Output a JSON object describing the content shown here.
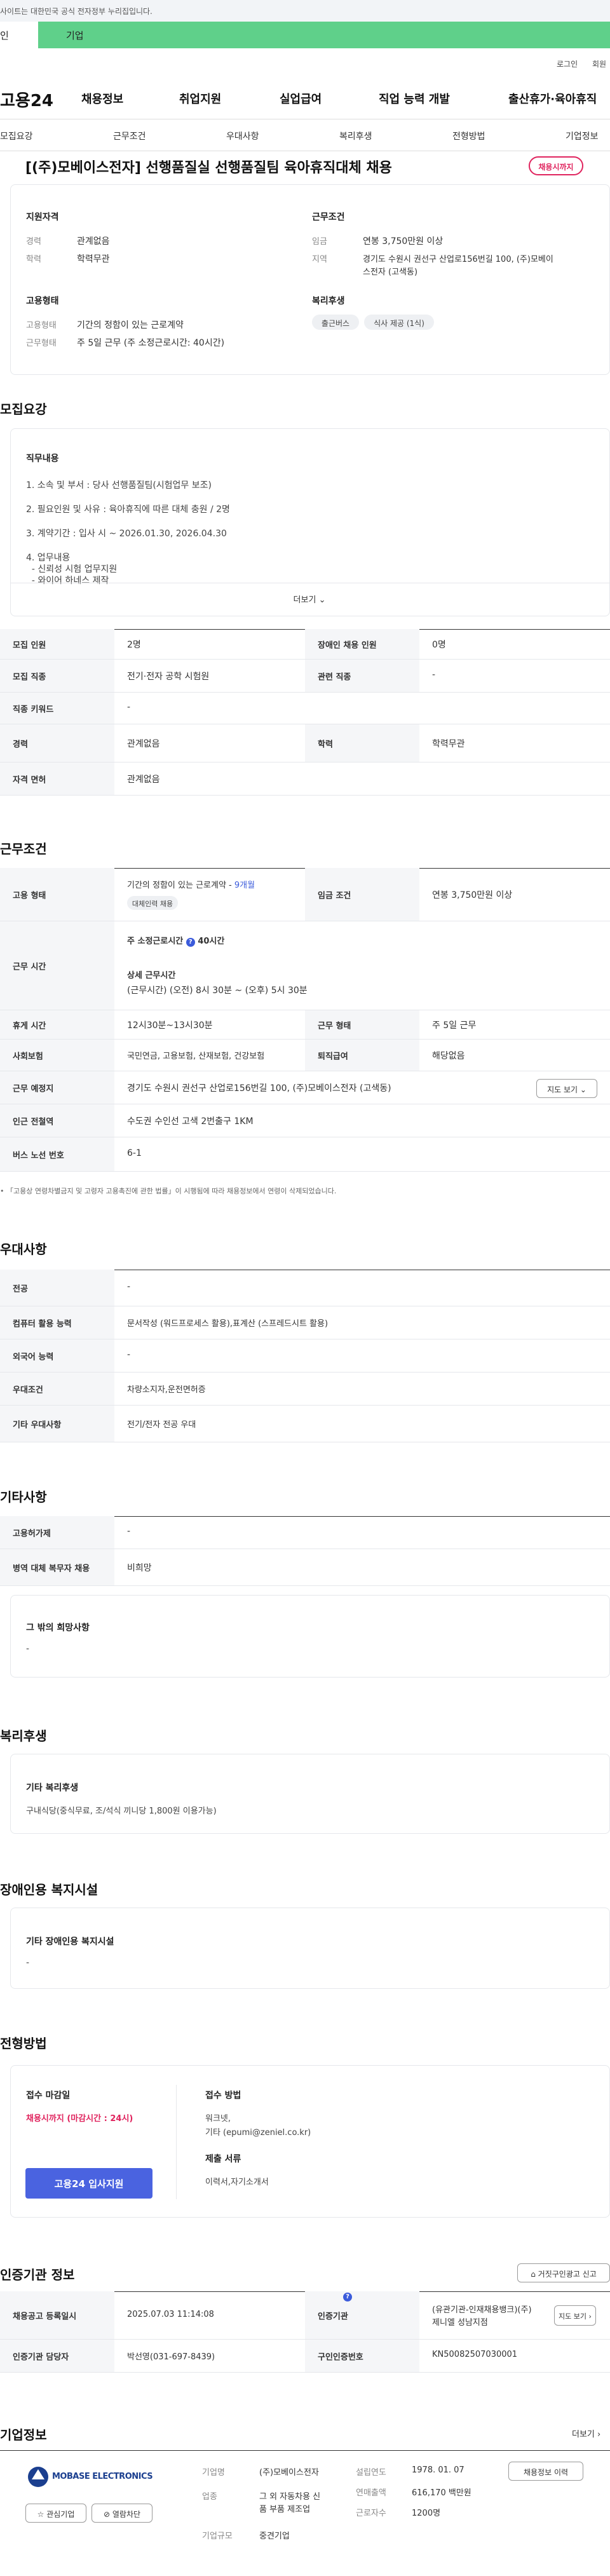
{
  "topbar": {
    "notice": "사이트는 대한민국 공식 전자정부 누리집입니다."
  },
  "mode": {
    "individual": "인",
    "business": "기업"
  },
  "util": {
    "login": "로그인",
    "join": "회원"
  },
  "gnb": {
    "logo": "고용24",
    "menus": [
      "채용정보",
      "취업지원",
      "실업급여",
      "직업 능력 개발",
      "출산휴가·육아휴직"
    ]
  },
  "tabs": [
    "모집요강",
    "근무조건",
    "우대사항",
    "복리후생",
    "전형방법",
    "기업정보"
  ],
  "job": {
    "title": "[(주)모베이스전자] 선행품질실 선행품질팀 육아휴직대체 채용",
    "status": "채용시까지"
  },
  "summary": {
    "qual_title": "지원자격",
    "career_label": "경력",
    "career": "관계없음",
    "edu_label": "학력",
    "edu": "학력무관",
    "cond_title": "근무조건",
    "wage_label": "임금",
    "wage": "연봉 3,750만원 이상",
    "area_label": "지역",
    "area_1": "경기도 수원시 권선구 산업로156번길 100, (주)모베이",
    "area_2": "스전자 (고색동)",
    "emp_title": "고용형태",
    "emp_label": "고용형태",
    "emp": "기간의 정함이 있는 근로계약",
    "hours_label": "근무형태",
    "hours": "주 5일 근무 (주 소정근로시간: 40시간)",
    "welfare_title": "복리후생",
    "welfare_chips": [
      "출근버스",
      "식사 제공 (1식)"
    ]
  },
  "recruit": {
    "heading": "모집요강",
    "duty_title": "직무내용",
    "lines": [
      "1. 소속 및 부서 : 당사 선행품질팀(시험업무 보조)",
      "2. 필요인원 및 사유 : 육아휴직에 따른 대체 충원 / 2명",
      "3. 계약기간 :  입사 시 ~ 2026.01.30, 2026.04.30",
      "4. 업무내용",
      "  - 신뢰성 시험 업무지원",
      "  - 와이어 하네스 제작"
    ],
    "more": "더보기",
    "rows": [
      {
        "h1": "모집 인원",
        "v1": "2명",
        "h2": "장애인 채용 인원",
        "v2": "0명"
      },
      {
        "h1": "모집 직종",
        "v1": "전기·전자 공학 시험원",
        "h2": "관련 직종",
        "v2": "-"
      },
      {
        "h1": "직종 키워드",
        "v1": "-"
      },
      {
        "h1": "경력",
        "v1": "관계없음",
        "h2": "학력",
        "v2": "학력무관"
      },
      {
        "h1": "자격 면허",
        "v1": "관계없음"
      }
    ]
  },
  "work": {
    "heading": "근무조건",
    "emp_h": "고용 형태",
    "emp_v": "기간의 정함이 있는 근로계약 - ",
    "emp_months": "9개월",
    "emp_chip": "대체인력 채용",
    "wage_h": "임금 조건",
    "wage_v": "연봉 3,750만원 이상",
    "time_h": "근무 시간",
    "time_sub1": "주 소정근로시간",
    "time_sub1_v": "40시간",
    "time_sub2": "상세 근무시간",
    "time_sub2_v": "(근무시간) (오전) 8시 30분 ~ (오후) 5시 30분",
    "rest_h": "휴게 시간",
    "rest_v": "12시30분~13시30분",
    "type_h": "근무 형태",
    "type_v": "주 5일 근무",
    "ins_h": "사회보험",
    "ins_v": "국민연금, 고용보험, 산재보험, 건강보험",
    "sev_h": "퇴직급여",
    "sev_v": "해당없음",
    "place_h": "근무 예정지",
    "place_v": "경기도 수원시 권선구 산업로156번길 100, (주)모베이스전자 (고색동)",
    "map_btn": "지도 보기",
    "metro_h": "인근 전철역",
    "metro_v": "수도권 수인선 고색 2번출구 1KM",
    "bus_h": "버스 노선 번호",
    "bus_v": "6-1",
    "note": "「고용상 연령차별금지 및 고령자 고용촉진에 관한 법률」이 시행됨에 따라 채용정보에서 연령이 삭제되었습니다."
  },
  "pref": {
    "heading": "우대사항",
    "rows": [
      {
        "h": "전공",
        "v": "-"
      },
      {
        "h": "컴퓨터 활용 능력",
        "v": "문서작성 (워드프로세스 활용),표계산 (스프레드시트 활용)"
      },
      {
        "h": "외국어 능력",
        "v": "-"
      },
      {
        "h": "우대조건",
        "v": "차량소지자,운전면허증"
      },
      {
        "h": "기타 우대사항",
        "v": "전기/전자 전공 우대"
      }
    ]
  },
  "etc": {
    "heading": "기타사항",
    "rows": [
      {
        "h": "고용허가제",
        "v": "-"
      },
      {
        "h": "병역 대체 복무자 채용",
        "v": "비희망"
      }
    ],
    "card_title": "그 밖의 희망사항",
    "card_value": "-"
  },
  "welfare": {
    "heading": "복리후생",
    "card_title": "기타 복리후생",
    "card_value": "구내식당(중식무료, 조/석식 끼니당 1,800원 이용가능)"
  },
  "disability": {
    "heading": "장애인용 복지시설",
    "card_title": "기타 장애인용 복지시설",
    "card_value": "-"
  },
  "process": {
    "heading": "전형방법",
    "deadline_title": "접수 마감일",
    "deadline": "채용시까지 (마감시간 : 24시)",
    "method_title": "접수 방법",
    "method_1": "워크넷,",
    "method_2": "기타 (epumi@zeniel.co.kr)",
    "docs_title": "제출 서류",
    "docs": "이력서,자기소개서",
    "apply_btn": "고용24 입사지원"
  },
  "cert": {
    "heading": "인증기관 정보",
    "report_btn": "거짓구인광고 신고",
    "reg_h": "채용공고 등록일시",
    "reg_v": "2025.07.03 11:14:08",
    "org_h": "인증기관",
    "org_v1": "(유관기관-인재채용뱅크)(주)",
    "org_v2": "제니엘 성남지점",
    "map_btn": "지도 보기",
    "mgr_h": "인증기관 담당자",
    "mgr_v": "박선영(031-697-8439)",
    "no_h": "구인인증번호",
    "no_v": "KN50082507030001"
  },
  "company": {
    "heading": "기업정보",
    "more": "더보기",
    "logo_text": "MOBASE ELECTRONICS",
    "name_h": "기업명",
    "name_v": "(주)모베이스전자",
    "ind_h": "업종",
    "ind_v1": "그 외 자동차용 신",
    "ind_v2": "품 부품 제조업",
    "size_h": "기업규모",
    "size_v": "중견기업",
    "est_h": "설립연도",
    "est_v": "1978. 01. 07",
    "sales_h": "연매출액",
    "sales_v": "616,170 백만원",
    "emp_h": "근로자수",
    "emp_v": "1200명",
    "jobs_btn": "채용정보 이력",
    "fav_btn": "관심기업",
    "block_btn": "열람차단"
  }
}
